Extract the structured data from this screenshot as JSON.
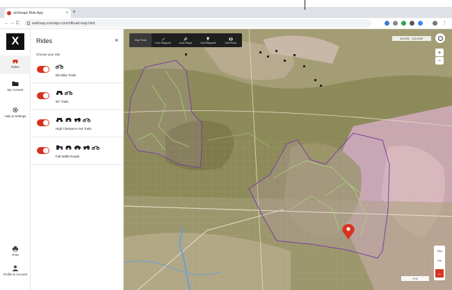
{
  "browser": {
    "tab_title": "onXmaps Ride App",
    "new_tab": "+",
    "url": "webmap.onxmaps.com/offroad-map.html",
    "nav": {
      "back": "←",
      "forward": "→",
      "reload": "C"
    },
    "extension_colors": [
      "#3a7bd5",
      "#888888",
      "#2ea44f",
      "#555555",
      "#4285f4",
      "#777777"
    ]
  },
  "rail": {
    "logo": "X",
    "items": [
      {
        "label": "Rides",
        "icon": "rides-icon",
        "active": true
      },
      {
        "label": "My Content",
        "icon": "folder-icon"
      },
      {
        "label": "Help & Settings",
        "icon": "gear-icon"
      }
    ],
    "bottom": [
      {
        "label": "Print",
        "icon": "print-icon"
      },
      {
        "label": "Profile & Account",
        "icon": "profile-icon"
      }
    ]
  },
  "rides_panel": {
    "title": "Rides",
    "close": "×",
    "subtitle": "Choose your ride",
    "items": [
      {
        "label": "Dirt Bike Trails",
        "vehicles": [
          "dirt-bike"
        ],
        "enabled": true
      },
      {
        "label": "50\" Trails",
        "vehicles": [
          "atv",
          "dirt-bike"
        ],
        "enabled": true
      },
      {
        "label": "High Clearance 4x4 Trails",
        "vehicles": [
          "atv",
          "side-by-side",
          "truck",
          "dirt-bike"
        ],
        "enabled": true
      },
      {
        "label": "Full Width Roads",
        "vehicles": [
          "tractor",
          "side-by-side",
          "car",
          "truck",
          "dirt-bike"
        ],
        "enabled": true
      }
    ]
  },
  "map_tools": [
    {
      "label": "Map Tools",
      "icon": "",
      "active": true
    },
    {
      "label": "Line Waypoint",
      "icon": "pen-icon"
    },
    {
      "label": "Area Shape",
      "icon": "shape-icon"
    },
    {
      "label": "Add Waypoint",
      "icon": "waypoint-icon"
    },
    {
      "label": "Add Photo",
      "icon": "camera-icon"
    }
  ],
  "map": {
    "coordinates": "34.8705°, -116.2036°",
    "zoom_in": "+",
    "zoom_out": "−",
    "layers": [
      "Topo",
      "Sat"
    ],
    "scale": "5 mi",
    "colors": {
      "boundary": "#7a3fa0",
      "trail": "#a8e070",
      "pin": "#d6331f",
      "accent": "#d6331f"
    }
  }
}
